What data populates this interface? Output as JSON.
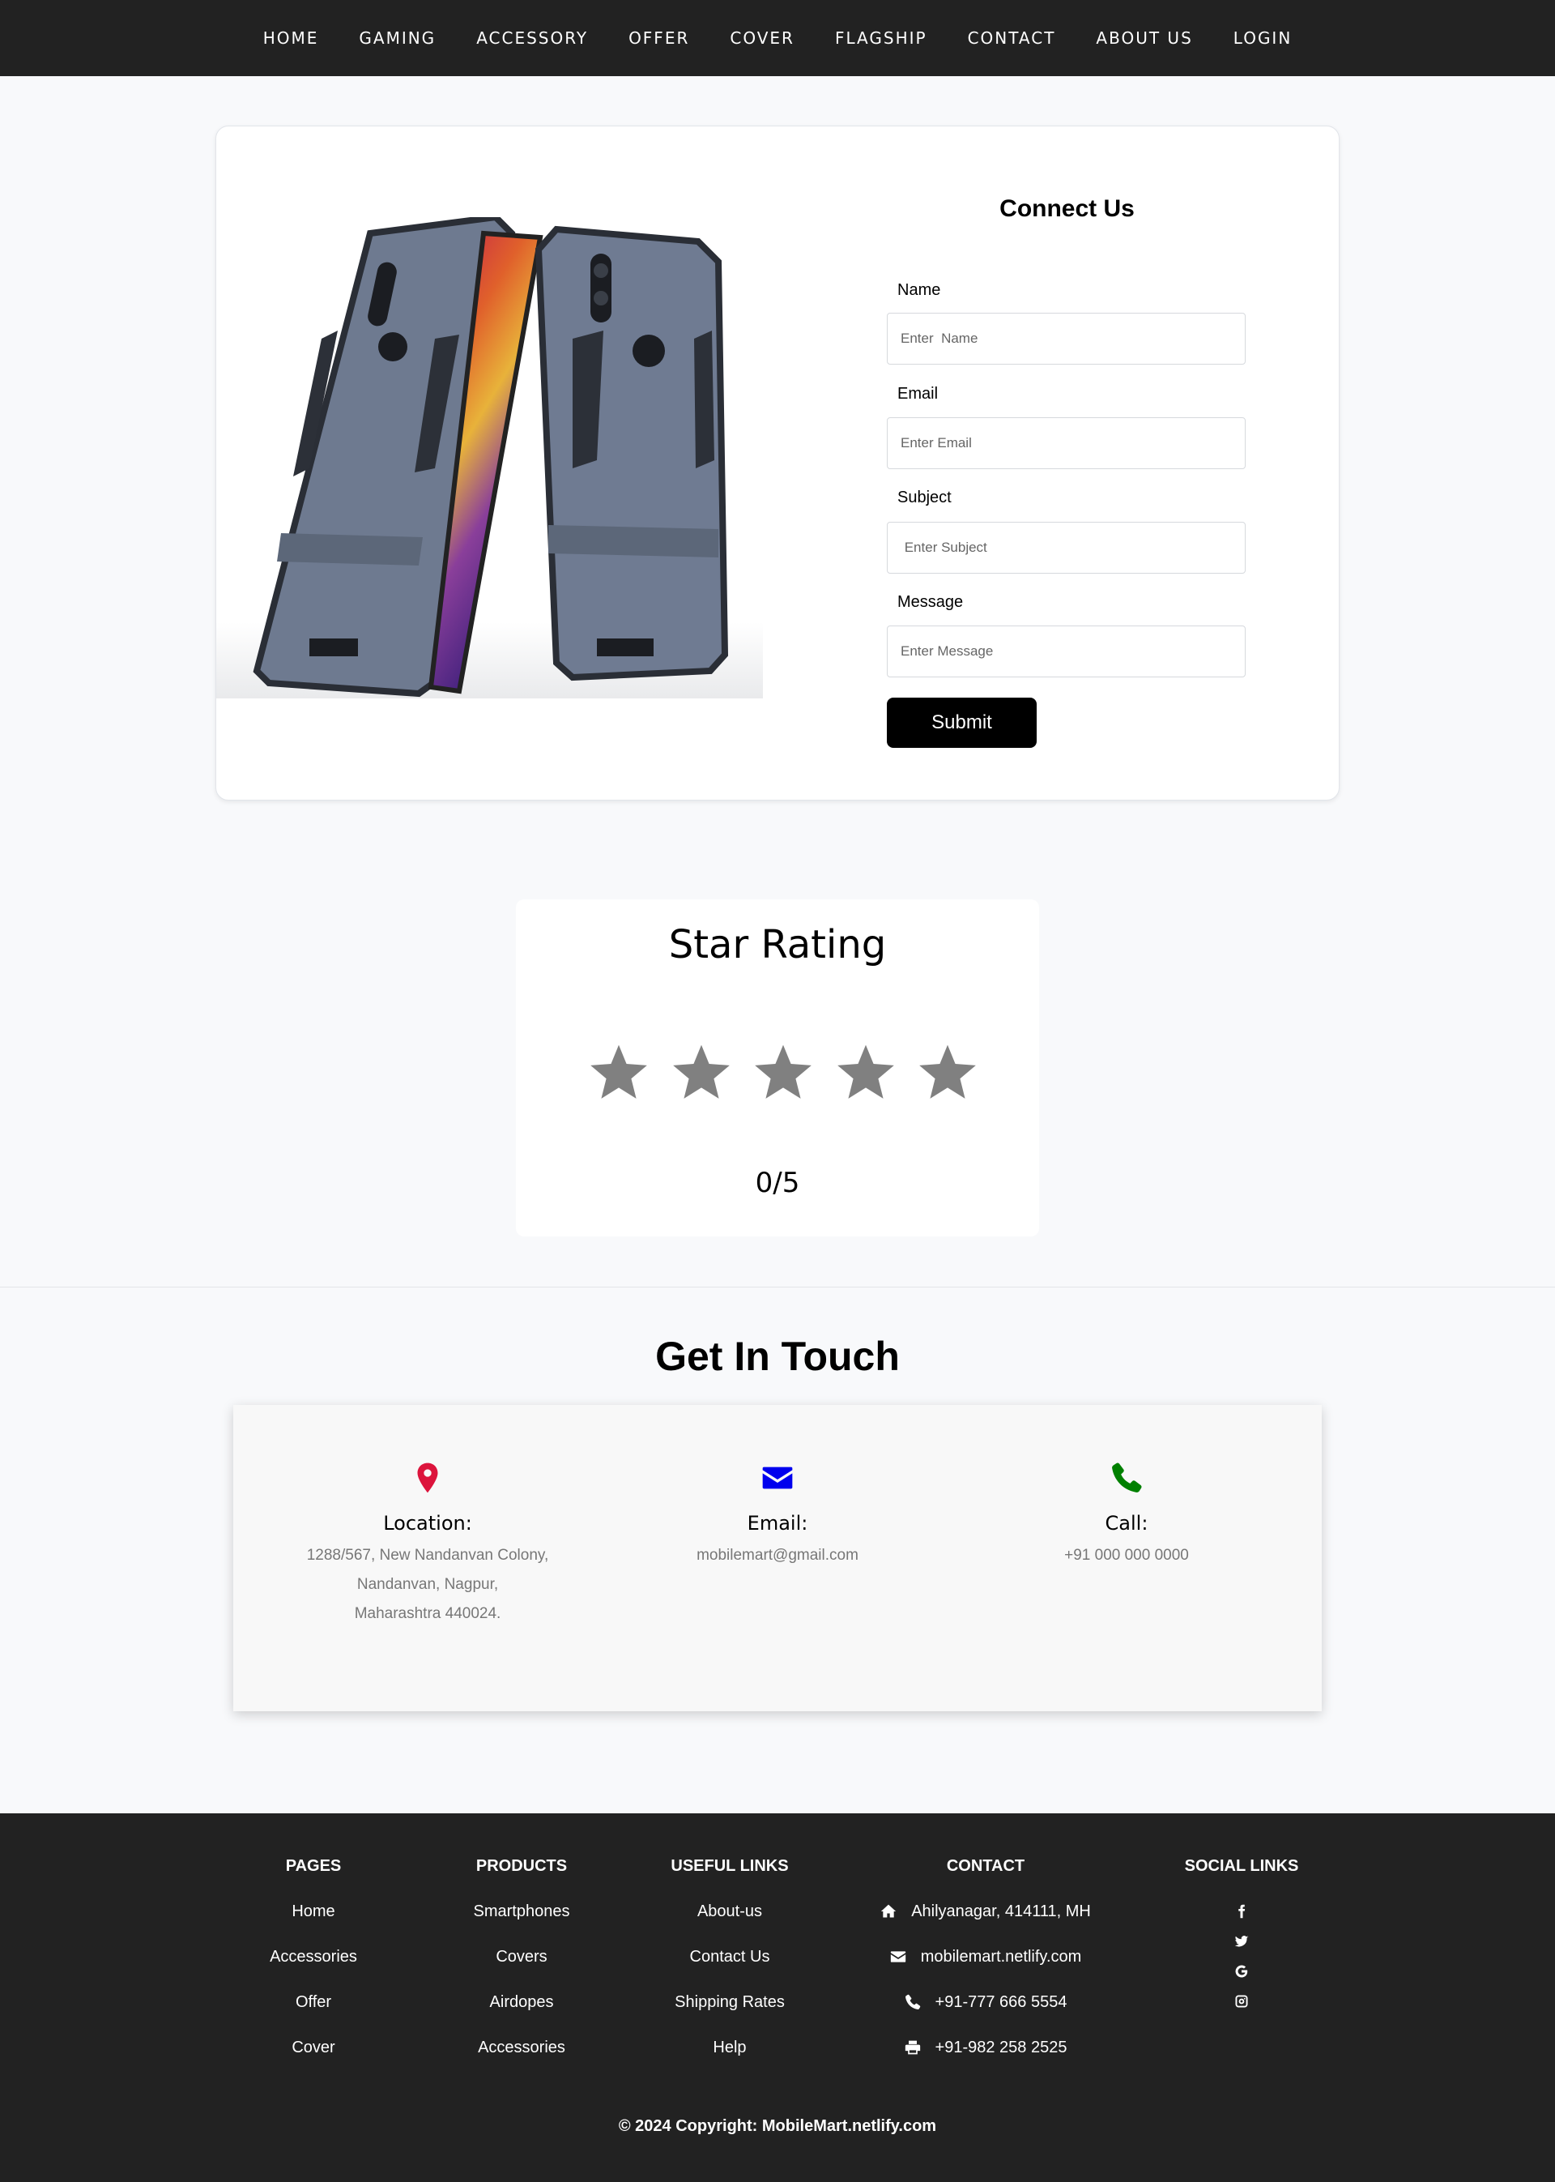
{
  "nav": {
    "items": [
      "HOME",
      "GAMING",
      "ACCESSORY",
      "OFFER",
      "COVER",
      "FLAGSHIP",
      "CONTACT",
      "ABOUT US",
      "LOGIN"
    ]
  },
  "contact_form": {
    "title": "Connect Us",
    "fields": [
      {
        "label": "Name",
        "placeholder": "Enter  Name"
      },
      {
        "label": "Email",
        "placeholder": "Enter Email"
      },
      {
        "label": "Subject",
        "placeholder": " Enter Subject"
      },
      {
        "label": "Message",
        "placeholder": "Enter Message"
      }
    ],
    "submit_label": "Submit"
  },
  "rating": {
    "title": "Star Rating",
    "value": 0,
    "max": 5,
    "display": "0/5",
    "star_color": "#808080"
  },
  "get_in_touch": {
    "title": "Get In Touch",
    "location": {
      "heading": "Location:",
      "lines": [
        "1288/567, New Nandanvan Colony,",
        "Nandanvan, Nagpur,",
        "Maharashtra 440024."
      ],
      "icon": "map-pin-icon",
      "color": "#dc143c"
    },
    "email": {
      "heading": "Email:",
      "text": "mobilemart@gmail.com",
      "icon": "envelope-icon",
      "color": "#0000ee"
    },
    "call": {
      "heading": "Call:",
      "text": "+91 000 000 0000",
      "icon": "phone-icon",
      "color": "#008000"
    }
  },
  "footer": {
    "pages": {
      "heading": "PAGES",
      "links": [
        "Home",
        "Accessories",
        "Offer",
        "Cover"
      ]
    },
    "products": {
      "heading": "PRODUCTS",
      "links": [
        "Smartphones",
        "Covers",
        "Airdopes",
        "Accessories"
      ]
    },
    "useful_links": {
      "heading": "USEFUL LINKS",
      "links": [
        "About-us",
        "Contact Us",
        "Shipping Rates",
        "Help"
      ]
    },
    "contact": {
      "heading": "CONTACT",
      "items": [
        {
          "icon": "home-icon",
          "text": "Ahilyanagar, 414111, MH"
        },
        {
          "icon": "envelope-icon",
          "text": "mobilemart.netlify.com"
        },
        {
          "icon": "phone-icon",
          "text": "+91-777 666 5554"
        },
        {
          "icon": "printer-icon",
          "text": "+91-982 258 2525"
        }
      ]
    },
    "social": {
      "heading": "SOCIAL LINKS",
      "icons": [
        "facebook-icon",
        "twitter-icon",
        "google-icon",
        "instagram-icon"
      ]
    },
    "copyright": "© 2024 Copyright: MobileMart.netlify.com"
  }
}
